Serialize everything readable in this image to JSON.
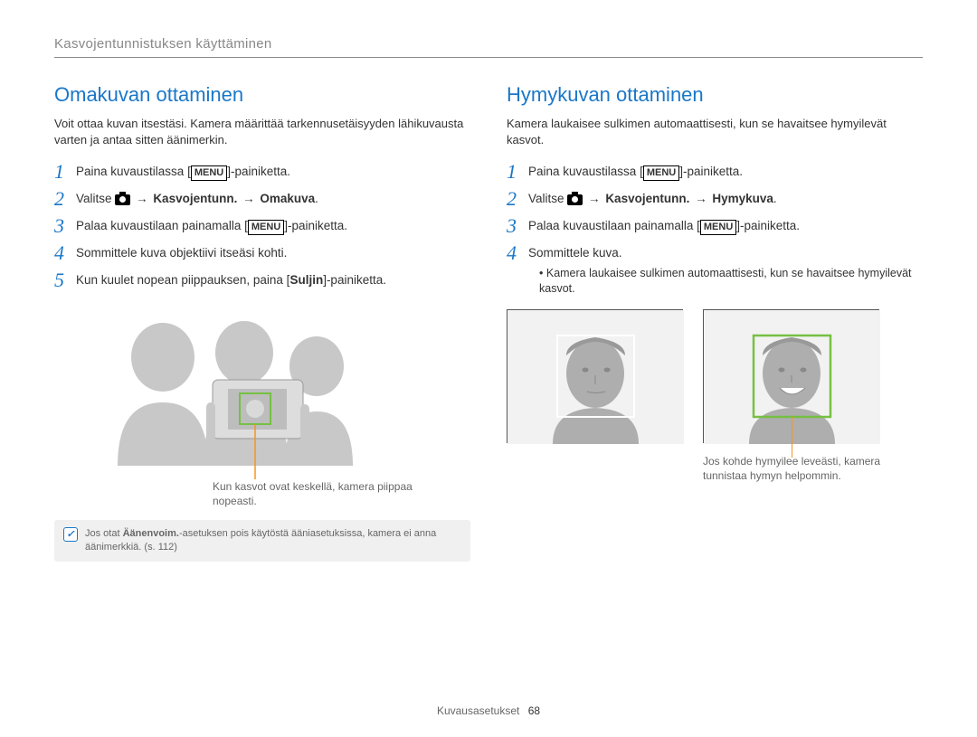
{
  "breadcrumb": "Kasvojentunnistuksen käyttäminen",
  "left": {
    "title": "Omakuvan ottaminen",
    "intro": "Voit ottaa kuvan itsestäsi. Kamera määrittää tarkennusetäisyyden lähikuvausta varten ja antaa sitten äänimerkin.",
    "step1_a": "Paina kuvaustilassa [",
    "step1_b": "]-painiketta.",
    "step2_a": "Valitse ",
    "step2_b_bold": "Kasvojentunn.",
    "step2_c_bold": "Omakuva",
    "step3_a": "Palaa kuvaustilaan painamalla [",
    "step3_b": "]-painiketta.",
    "step4": "Sommittele kuva objektiivi itseäsi kohti.",
    "step5_a": "Kun kuulet nopean piippauksen, paina [",
    "step5_b_bold": "Suljin",
    "step5_c": "]-painiketta.",
    "caption": "Kun kasvot ovat keskellä, kamera piippaa nopeasti.",
    "note_a": "Jos otat ",
    "note_bold": "Äänenvoim.",
    "note_b": "-asetuksen pois käytöstä ääniasetuksissa, kamera ei anna äänimerkkiä. (s. 112)"
  },
  "right": {
    "title": "Hymykuvan ottaminen",
    "intro": "Kamera laukaisee sulkimen automaattisesti, kun se havaitsee hymyilevät kasvot.",
    "step1_a": "Paina kuvaustilassa [",
    "step1_b": "]-painiketta.",
    "step2_a": "Valitse ",
    "step2_b_bold": "Kasvojentunn.",
    "step2_c_bold": "Hymykuva",
    "step3_a": "Palaa kuvaustilaan painamalla [",
    "step3_b": "]-painiketta.",
    "step4": "Sommittele kuva.",
    "bullet": "Kamera laukaisee sulkimen automaattisesti, kun se havaitsee hymyilevät kasvot.",
    "caption": "Jos kohde hymyilee leveästi, kamera tunnistaa hymyn helpommin."
  },
  "labels": {
    "menu": "MENU",
    "arrow": "→"
  },
  "footer": {
    "section": "Kuvausasetukset",
    "page": "68"
  }
}
